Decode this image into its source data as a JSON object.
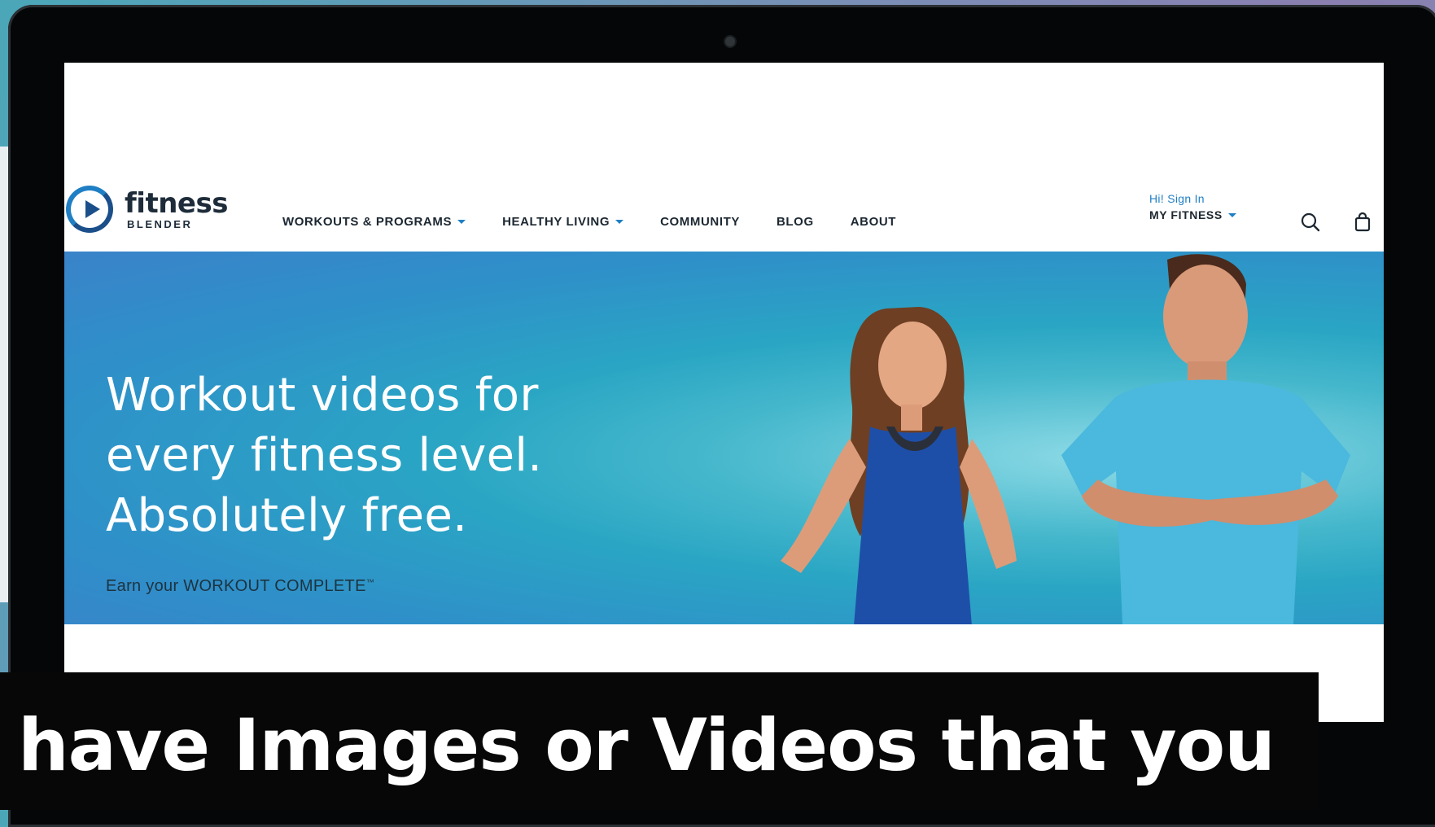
{
  "logo": {
    "word": "fitness",
    "sub": "BLENDER"
  },
  "nav": {
    "items": [
      {
        "label": "WORKOUTS & PROGRAMS",
        "dropdown": true
      },
      {
        "label": "HEALTHY LIVING",
        "dropdown": true
      },
      {
        "label": "COMMUNITY",
        "dropdown": false
      },
      {
        "label": "BLOG",
        "dropdown": false
      },
      {
        "label": "ABOUT",
        "dropdown": false
      }
    ],
    "account": {
      "greeting": "Hi! Sign In",
      "menu": "MY FITNESS"
    },
    "icons": [
      "search-icon",
      "shopping-bag-icon"
    ]
  },
  "hero": {
    "headline": [
      "Workout videos for",
      "every fitness level.",
      "Absolutely free."
    ],
    "tagline": "Earn your WORKOUT COMPLETE",
    "tagline_mark": "™"
  },
  "caption": {
    "text": "have Images or Videos that you"
  },
  "colors": {
    "accent": "#1f7fc4",
    "hero_blue": "#2f8fc9",
    "hero_teal": "#45b7cc",
    "caption_bg": "#070707"
  }
}
